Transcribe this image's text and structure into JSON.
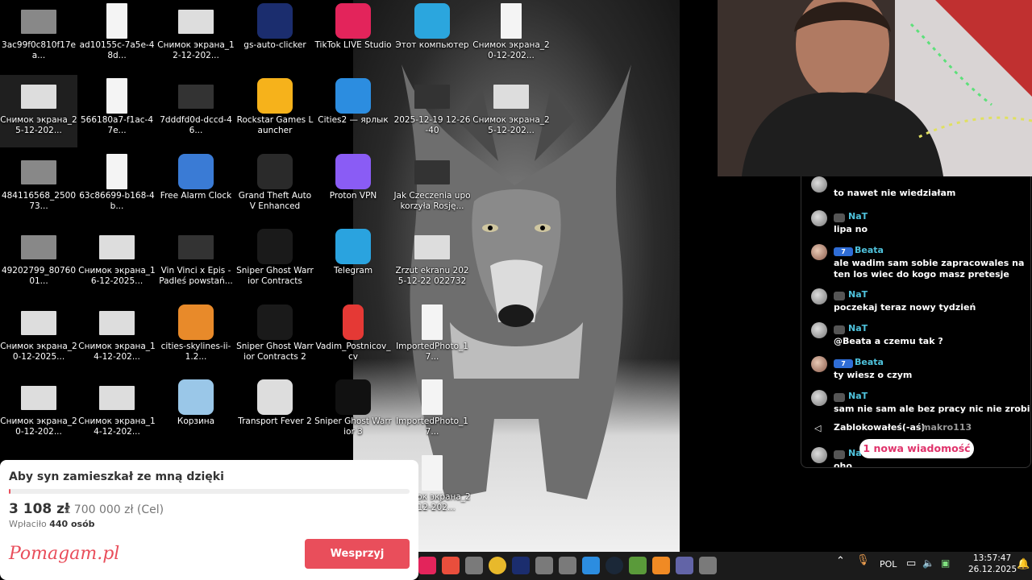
{
  "desktop": {
    "icons": [
      {
        "label": "3ac99f0c810f17ea...",
        "icon": "image-thumbnail-icon"
      },
      {
        "label": "Снимок экрана_25-12-202...",
        "icon": "screenshot-icon"
      },
      {
        "label": "484116568_250073...",
        "icon": "image-thumbnail-icon"
      },
      {
        "label": "49202799_8076001...",
        "icon": "image-thumbnail-icon"
      },
      {
        "label": "Снимок экрана_20-12-2025...",
        "icon": "screenshot-icon"
      },
      {
        "label": "Снимок экрана_20-12-202...",
        "icon": "screenshot-icon"
      },
      {
        "label": "ad10155c-7a5e-48d...",
        "icon": "document-icon"
      },
      {
        "label": "566180a7-f1ac-47e...",
        "icon": "document-icon"
      },
      {
        "label": "63c86699-b168-4b...",
        "icon": "document-icon"
      },
      {
        "label": "Снимок экрана_16-12-2025...",
        "icon": "screenshot-icon"
      },
      {
        "label": "Снимок экрана_14-12-202...",
        "icon": "screenshot-icon"
      },
      {
        "label": "Снимок экрана_14-12-202...",
        "icon": "screenshot-icon"
      },
      {
        "label": "Снимок экрана_12-12-202...",
        "icon": "screenshot-icon"
      },
      {
        "label": "7dddfd0d-dccd-46...",
        "icon": "video-thumbnail-icon"
      },
      {
        "label": "Free Alarm Clock",
        "icon": "alarm-clock-icon"
      },
      {
        "label": "Vin Vinci x Epis - Padleś powstań...",
        "icon": "video-thumbnail-icon"
      },
      {
        "label": "cities-skylines-ii-1.2...",
        "icon": "rocket-icon"
      },
      {
        "label": "Корзина",
        "icon": "recycle-bin-icon"
      },
      {
        "label": "gs-auto-clicker",
        "icon": "star-icon"
      },
      {
        "label": "Rockstar Games Launcher",
        "icon": "rockstar-icon"
      },
      {
        "label": "Grand Theft Auto V Enhanced",
        "icon": "gta-icon"
      },
      {
        "label": "Sniper Ghost Warrior Contracts",
        "icon": "sgw-icon"
      },
      {
        "label": "Sniper Ghost Warrior Contracts 2",
        "icon": "sgw-icon"
      },
      {
        "label": "Transport Fever 2",
        "icon": "transport-fever-icon"
      },
      {
        "label": "TikTok LIVE Studio",
        "icon": "tiktok-icon"
      },
      {
        "label": "Cities2 — ярлык",
        "icon": "cities2-icon"
      },
      {
        "label": "Proton VPN",
        "icon": "protonvpn-icon"
      },
      {
        "label": "Telegram",
        "icon": "telegram-icon"
      },
      {
        "label": "Vadim_Postnicov_cv",
        "icon": "pdf-icon"
      },
      {
        "label": "Sniper Ghost Warrior 3",
        "icon": "sgw3-icon"
      },
      {
        "label": "Этот компьютер",
        "icon": "computer-icon"
      },
      {
        "label": "2025-12-19 12-26-40",
        "icon": "video-thumbnail-icon"
      },
      {
        "label": "Jak Czeczenia upokorzyła Rosję...",
        "icon": "video-thumbnail-icon"
      },
      {
        "label": "Zrzut ekranu 2025-12-22 022732",
        "icon": "screenshot-icon"
      },
      {
        "label": "ImportedPhoto_17...",
        "icon": "document-icon"
      },
      {
        "label": "ImportedPhoto_17...",
        "icon": "document-icon"
      },
      {
        "label": "Снимок экрана_20-12-202...",
        "icon": "document-icon"
      },
      {
        "label": "Снимок экрана_20-12-202...",
        "icon": "document-icon"
      },
      {
        "label": "Снимок экрана_25-12-202...",
        "icon": "screenshot-icon"
      }
    ]
  },
  "chat": {
    "messages": [
      {
        "name": "",
        "text": "to nawet nie wiedziałam",
        "level": "",
        "avatar": "gray"
      },
      {
        "name": "NaT",
        "text": "lipa no",
        "level": "",
        "avatar": "gray"
      },
      {
        "name": "Beata",
        "text": "ale wadim sam sobie zapracowales na ten los wiec do kogo masz pretesje",
        "level": "7",
        "avatar": "beata"
      },
      {
        "name": "NaT",
        "text": "poczekaj teraz nowy tydzień",
        "level": "",
        "avatar": "gray"
      },
      {
        "name": "NaT",
        "text": "@Beata a czemu tak ?",
        "level": "",
        "avatar": "gray"
      },
      {
        "name": "Beata",
        "text": "ty wiesz o czym",
        "level": "7",
        "avatar": "beata"
      },
      {
        "name": "NaT",
        "text": "sam nie sam ale bez pracy nic nie zrobi",
        "level": "",
        "avatar": "gray"
      }
    ],
    "system_message": {
      "prefix": "Zablokowałeś(-aś)",
      "user": "makro113"
    },
    "last_message": {
      "name": "NaT",
      "text": "oho"
    },
    "new_messages_label": "1 nowa wiadomość"
  },
  "donation": {
    "title": "Aby syn zamieszkał ze mną dzięki",
    "amount": "3 108 zł",
    "goal": "z 700 000 zł (Cel)",
    "paid_prefix": "Wpłaciło",
    "paid_count": "440 osób",
    "progress_fraction": 0.0044,
    "logo": "Pomagam.pl",
    "button": "Wesprzyj",
    "accent": "#e94e5b"
  },
  "taskbar": {
    "apps": [
      "tiktok-icon",
      "rockstar-icon",
      "app-icon",
      "chrome-icon",
      "star-icon",
      "app-icon",
      "app-icon",
      "photos-icon",
      "steam-icon",
      "minecraft-icon",
      "media-icon",
      "teams-icon",
      "app-icon"
    ],
    "language": "POL",
    "time": "13:57:47",
    "date": "26.12.2025"
  }
}
